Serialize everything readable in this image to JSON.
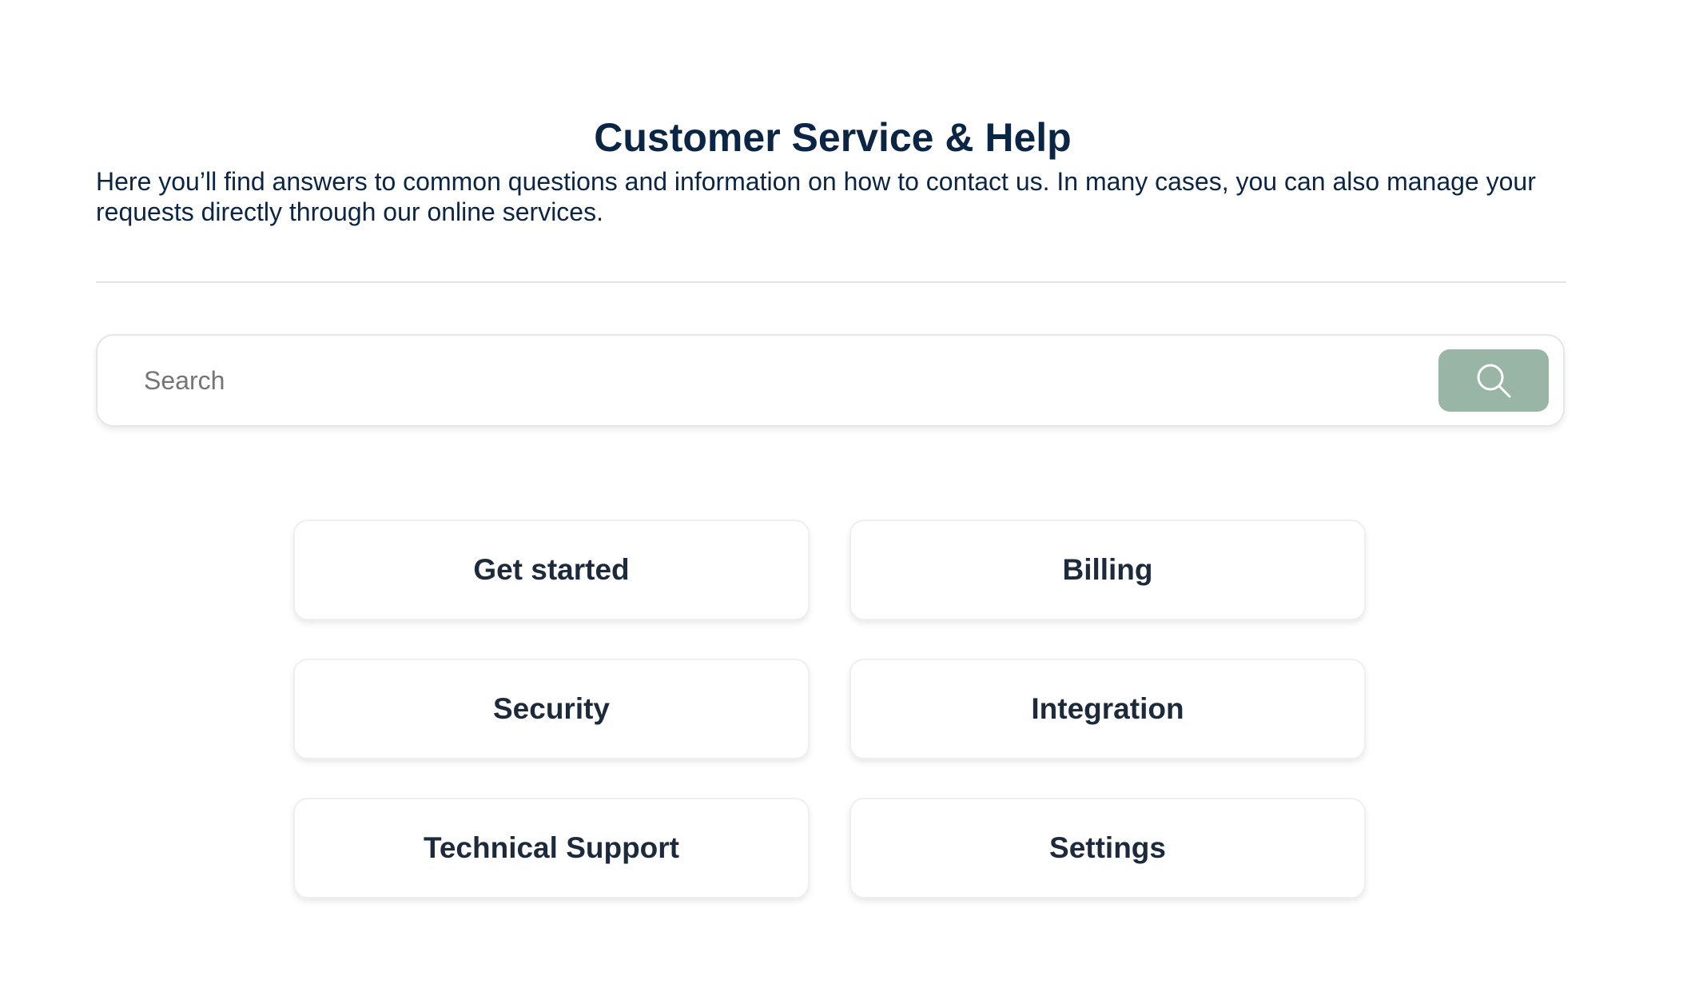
{
  "page": {
    "title": "Customer Service & Help",
    "intro": "Here you’ll find answers to common questions and information on how to contact us. In many cases, you can also manage your requests directly through our online services."
  },
  "search": {
    "placeholder": "Search",
    "value": "",
    "button_icon": "search-icon",
    "button_color": "#98b5a6"
  },
  "categories": [
    {
      "label": "Get started"
    },
    {
      "label": "Billing"
    },
    {
      "label": "Security"
    },
    {
      "label": "Integration"
    },
    {
      "label": "Technical Support"
    },
    {
      "label": "Settings"
    }
  ],
  "colors": {
    "heading": "#0b2545",
    "card_text": "#1d2a3b",
    "background": "#ffffff"
  }
}
